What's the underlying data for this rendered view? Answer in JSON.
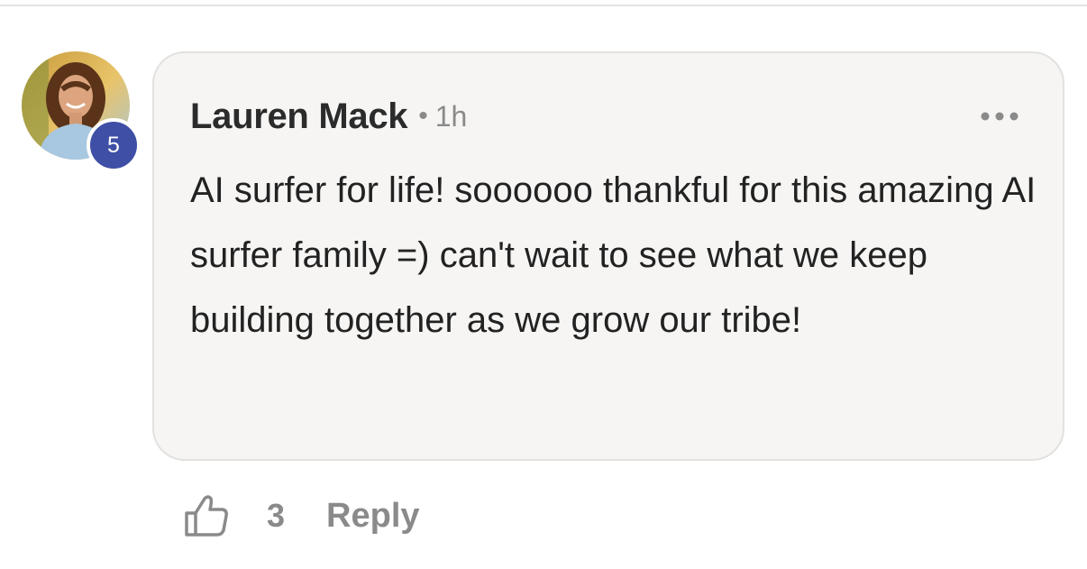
{
  "comment": {
    "author": "Lauren Mack",
    "level_badge": "5",
    "separator": "•",
    "timestamp": "1h",
    "text": "AI surfer for life! soooooo thankful for this amazing AI surfer family =) can't wait to see what we keep building together as we grow our tribe!",
    "more_icon": "more-horizontal-icon"
  },
  "actions": {
    "like_icon": "thumbs-up-icon",
    "like_count": "3",
    "reply_label": "Reply"
  },
  "colors": {
    "bubble_background": "#f6f5f4",
    "badge": "#3f4fa6",
    "muted_text": "#8a8a8a",
    "primary_text": "#222222"
  }
}
